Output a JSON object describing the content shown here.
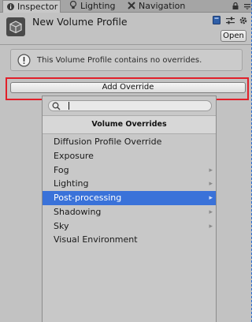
{
  "tabs": [
    {
      "label": "Inspector",
      "icon": "info-icon",
      "active": true
    },
    {
      "label": "Lighting",
      "icon": "bulb-icon",
      "active": false
    },
    {
      "label": "Navigation",
      "icon": "navigation-icon",
      "active": false
    }
  ],
  "header": {
    "title": "New Volume Profile",
    "open_label": "Open"
  },
  "help": {
    "message": "This Volume Profile contains no overrides."
  },
  "add_override": {
    "label": "Add Override"
  },
  "dropdown": {
    "search_value": "",
    "header": "Volume Overrides",
    "items": [
      {
        "label": "Diffusion Profile Override",
        "has_submenu": false,
        "selected": false
      },
      {
        "label": "Exposure",
        "has_submenu": false,
        "selected": false
      },
      {
        "label": "Fog",
        "has_submenu": true,
        "selected": false
      },
      {
        "label": "Lighting",
        "has_submenu": true,
        "selected": false
      },
      {
        "label": "Post-processing",
        "has_submenu": true,
        "selected": true
      },
      {
        "label": "Shadowing",
        "has_submenu": true,
        "selected": false
      },
      {
        "label": "Sky",
        "has_submenu": true,
        "selected": false
      },
      {
        "label": "Visual Environment",
        "has_submenu": false,
        "selected": false
      }
    ]
  },
  "colors": {
    "highlight": "#3a72d9",
    "annotation": "#e1202a",
    "panel_bg": "#c2c2c2"
  }
}
